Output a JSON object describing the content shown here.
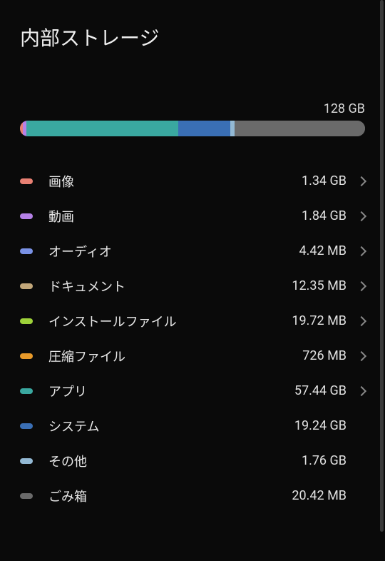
{
  "title": "内部ストレージ",
  "total_capacity": "128 GB",
  "bar_segments": [
    {
      "name": "images",
      "color": "#e88073",
      "width": 0.8
    },
    {
      "name": "videos",
      "color": "#b581e7",
      "width": 1.1
    },
    {
      "name": "apps",
      "color": "#3aa8a0",
      "width": 44.0
    },
    {
      "name": "system",
      "color": "#3a6fb5",
      "width": 15.0
    },
    {
      "name": "other",
      "color": "#93b9d4",
      "width": 1.4
    },
    {
      "name": "free",
      "color": "#6a6a6a",
      "width": 37.7
    }
  ],
  "categories": [
    {
      "key": "images",
      "label": "画像",
      "size": "1.34 GB",
      "color": "#e88073",
      "navigable": true
    },
    {
      "key": "videos",
      "label": "動画",
      "size": "1.84 GB",
      "color": "#b581e7",
      "navigable": true
    },
    {
      "key": "audio",
      "label": "オーディオ",
      "size": "4.42 MB",
      "color": "#7a92e6",
      "navigable": true
    },
    {
      "key": "documents",
      "label": "ドキュメント",
      "size": "12.35 MB",
      "color": "#c2a77a",
      "navigable": true
    },
    {
      "key": "install",
      "label": "インストールファイル",
      "size": "19.72 MB",
      "color": "#9ed23a",
      "navigable": true
    },
    {
      "key": "compressed",
      "label": "圧縮ファイル",
      "size": "726 MB",
      "color": "#e89a2a",
      "navigable": true
    },
    {
      "key": "apps",
      "label": "アプリ",
      "size": "57.44 GB",
      "color": "#3aa8a0",
      "navigable": true
    },
    {
      "key": "system",
      "label": "システム",
      "size": "19.24 GB",
      "color": "#3a6fb5",
      "navigable": false
    },
    {
      "key": "other",
      "label": "その他",
      "size": "1.76 GB",
      "color": "#93b9d4",
      "navigable": false
    },
    {
      "key": "trash",
      "label": "ごみ箱",
      "size": "20.42 MB",
      "color": "#6a6a6a",
      "navigable": false
    }
  ]
}
